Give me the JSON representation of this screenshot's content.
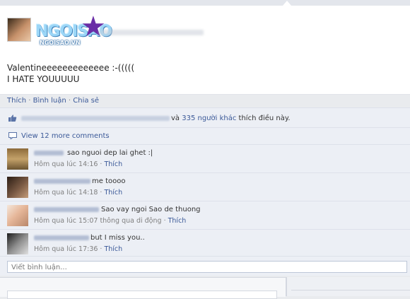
{
  "post": {
    "logo_text": "NGOISAO",
    "logo_sub": "NGOISAO.VN",
    "body_lines": [
      "Valentineeeeeeeeeeeee :-(((((",
      "I HATE YOUUUUU"
    ]
  },
  "actions": {
    "like": "Thích",
    "comment": "Bình luận",
    "share": "Chia sẻ",
    "separator": "·"
  },
  "likes": {
    "others_link": "335 người khác",
    "prefix": "và",
    "suffix": "thích điều này."
  },
  "view_more": "View 12 more comments",
  "comments": [
    {
      "text": "sao nguoi dep lai ghet :|",
      "time": "Hôm qua lúc 14:16",
      "via": "",
      "like": "Thích"
    },
    {
      "text": "me toooo",
      "time": "Hôm qua lúc 14:18",
      "via": "",
      "like": "Thích"
    },
    {
      "text": "Sao vay ngoi Sao de thuong",
      "time": "Hôm qua lúc 15:07",
      "via": "thông qua di động",
      "like": "Thích"
    },
    {
      "text": "but I miss you..",
      "time": "Hôm qua lúc 17:36",
      "via": "",
      "like": "Thích"
    }
  ],
  "write_placeholder": "Viết bình luận...",
  "colors": {
    "link": "#3b5998",
    "feedback_bg": "#eceff5",
    "meta": "#808080"
  }
}
